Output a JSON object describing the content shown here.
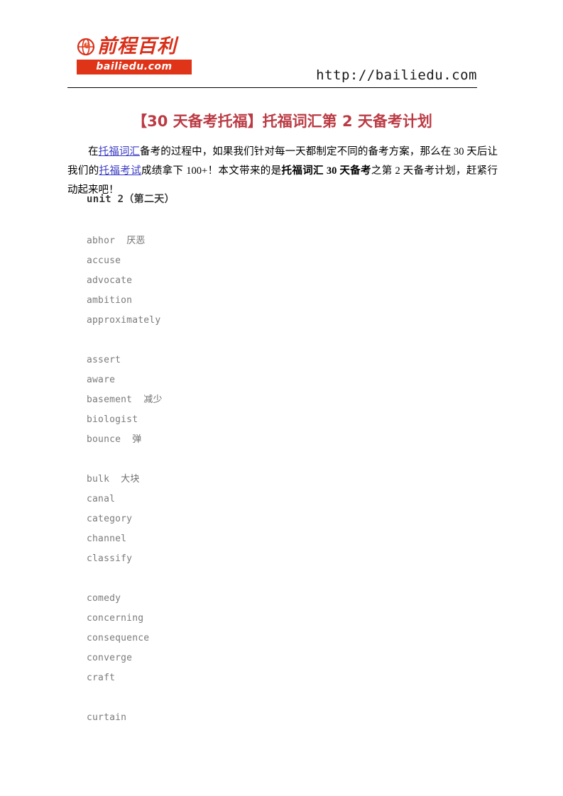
{
  "header": {
    "logo": {
      "icon": "globe-icon",
      "brand_cn": "前程百利",
      "brand_domain": "bailiedu.com"
    },
    "site_url": "http://bailiedu.com"
  },
  "article": {
    "title": "【30 天备考托福】托福词汇第 2 天备考计划",
    "intro": {
      "seg1": "在",
      "link1": "托福词汇",
      "seg2": "备考的过程中，如果我们针对每一天都制定不同的备考方案，那么在 30 天后让我们的",
      "link2": "托福考试",
      "seg3": "成绩拿下 100+！本文带来的是",
      "bold1": "托福词汇 30 天备考",
      "seg4": "之第 2 天备考计划，赶紧行动起来吧！"
    },
    "unit_heading": "unit 2（第二天）",
    "word_groups": [
      {
        "words": [
          {
            "term": "abhor",
            "gloss": "厌恶"
          },
          {
            "term": "accuse",
            "gloss": ""
          },
          {
            "term": "advocate",
            "gloss": ""
          },
          {
            "term": "ambition",
            "gloss": ""
          },
          {
            "term": "approximately",
            "gloss": ""
          }
        ]
      },
      {
        "words": [
          {
            "term": "assert",
            "gloss": ""
          },
          {
            "term": "aware",
            "gloss": ""
          },
          {
            "term": "basement",
            "gloss": "减少"
          },
          {
            "term": "biologist",
            "gloss": ""
          },
          {
            "term": "bounce",
            "gloss": "弹"
          }
        ]
      },
      {
        "words": [
          {
            "term": "bulk",
            "gloss": "大块"
          },
          {
            "term": "canal",
            "gloss": ""
          },
          {
            "term": "category",
            "gloss": ""
          },
          {
            "term": "channel",
            "gloss": ""
          },
          {
            "term": "classify",
            "gloss": ""
          }
        ]
      },
      {
        "words": [
          {
            "term": "comedy",
            "gloss": ""
          },
          {
            "term": "concerning",
            "gloss": ""
          },
          {
            "term": "consequence",
            "gloss": ""
          },
          {
            "term": "converge",
            "gloss": ""
          },
          {
            "term": "craft",
            "gloss": ""
          }
        ]
      },
      {
        "words": [
          {
            "term": "curtain",
            "gloss": ""
          }
        ]
      }
    ]
  },
  "colors": {
    "logo_red": "#e03419",
    "title_red": "#bb3b44",
    "link_blue": "#3b3bc4",
    "word_gray": "#7b7b7b"
  }
}
